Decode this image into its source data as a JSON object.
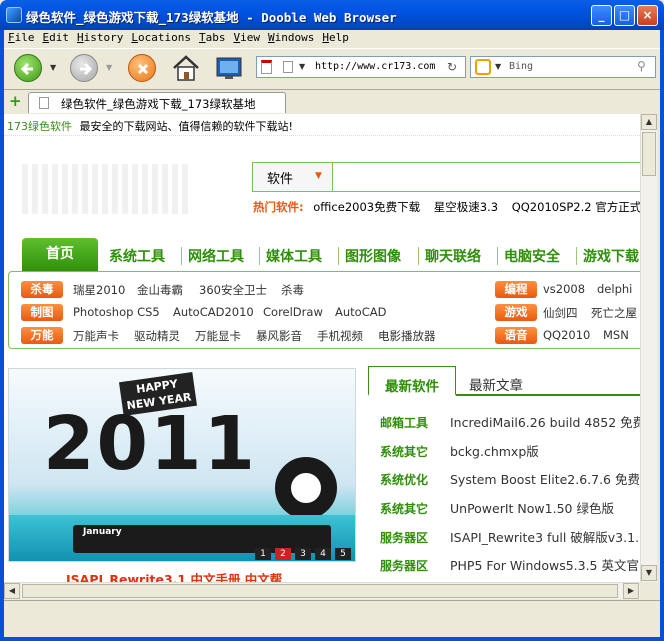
{
  "window": {
    "title": "绿色软件_绿色游戏下载_173绿软基地 - Dooble Web Browser",
    "min": "_",
    "max": "□",
    "close": "×"
  },
  "menu": [
    "File",
    "Edit",
    "History",
    "Locations",
    "Tabs",
    "View",
    "Windows",
    "Help"
  ],
  "toolbar": {
    "url": "http://www.cr173.com",
    "search_placeholder": "Bing"
  },
  "tab": {
    "label": "绿色软件_绿色游戏下载_173绿软基地"
  },
  "page": {
    "brand": "173绿色软件",
    "slogan": "最安全的下载网站、值得信赖的软件下载站!",
    "search": {
      "category": "软件",
      "hot_label": "热门软件:",
      "hot": [
        "office2003免费下载",
        "星空极速3.3",
        "QQ2010SP2.2 官方正式"
      ]
    },
    "nav": [
      "首页",
      "系统工具",
      "网络工具",
      "媒体工具",
      "图形图像",
      "聊天联络",
      "电脑安全",
      "游戏下载"
    ],
    "rows": [
      {
        "badge": "杀毒",
        "links": [
          "瑞星2010",
          "金山毒霸",
          "360安全卫士",
          "杀毒"
        ],
        "rbadge": "编程",
        "rlinks": [
          "vs2008",
          "delphi"
        ]
      },
      {
        "badge": "制图",
        "links": [
          "Photoshop CS5",
          "AutoCAD2010",
          "CorelDraw",
          "AutoCAD"
        ],
        "rbadge": "游戏",
        "rlinks": [
          "仙剑四",
          "死亡之屋"
        ]
      },
      {
        "badge": "万能",
        "links": [
          "万能声卡",
          "驱动精灵",
          "万能显卡",
          "暴风影音",
          "手机视频",
          "电影播放器"
        ],
        "rbadge": "语音",
        "rlinks": [
          "QQ2010",
          "MSN"
        ]
      }
    ],
    "banner": {
      "happy": "HAPPY",
      "newyear": "NEW YEAR",
      "year": "2011",
      "month": "January",
      "pages": [
        "1",
        "2",
        "3",
        "4",
        "5"
      ],
      "caption": "ISAPI_Rewrite3.1 中文手册 中文帮"
    },
    "rtabs": [
      "最新软件",
      "最新文章"
    ],
    "latest": [
      {
        "cat": "邮箱工具",
        "title": "IncrediMail6.26 build 4852 免费"
      },
      {
        "cat": "系统其它",
        "title": "bckg.chmxp版"
      },
      {
        "cat": "系统优化",
        "title": "System Boost Elite2.6.7.6 免费"
      },
      {
        "cat": "系统其它",
        "title": "UnPowerIt Now1.50 绿色版"
      },
      {
        "cat": "服务器区",
        "title": "ISAPI_Rewrite3 full 破解版v3.1."
      },
      {
        "cat": "服务器区",
        "title": "PHP5 For Windows5.3.5 英文官"
      }
    ]
  },
  "colors": {
    "accent_green": "#3a8a1a",
    "badge_orange": "#e85a10",
    "caption_red": "#e03010"
  }
}
